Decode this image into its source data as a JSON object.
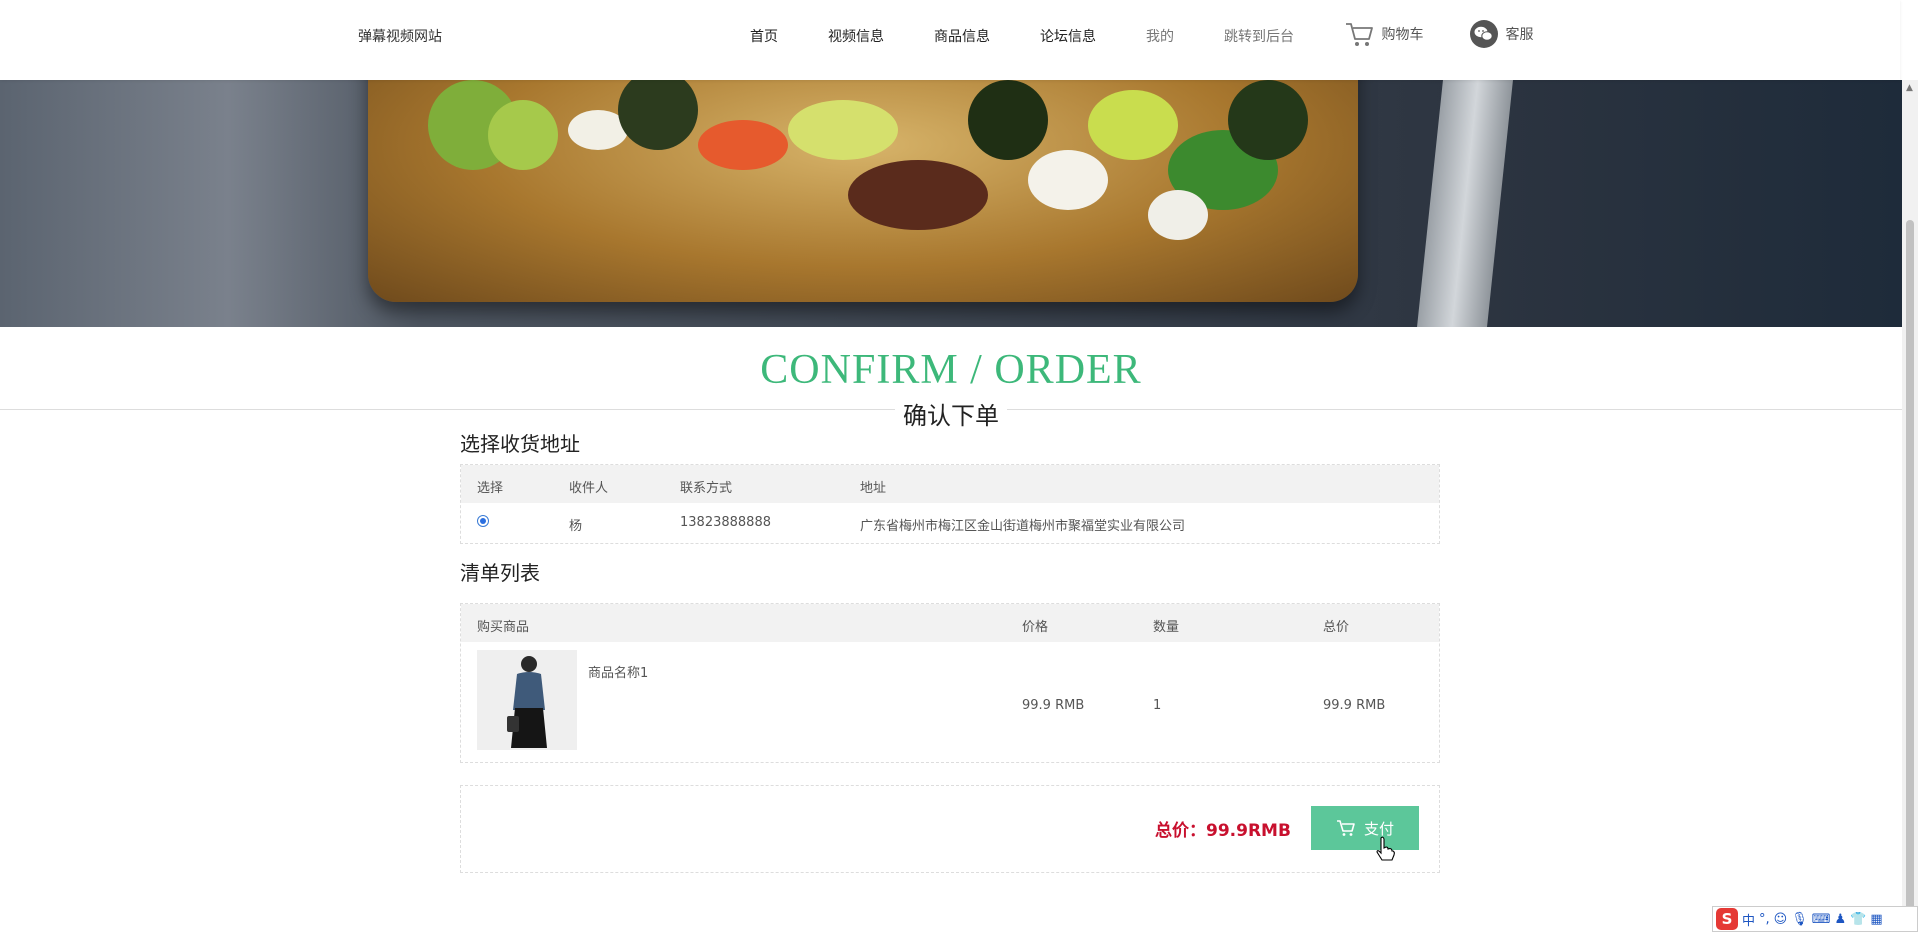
{
  "header": {
    "site_title": "弹幕视频网站",
    "nav": [
      "首页",
      "视频信息",
      "商品信息",
      "论坛信息",
      "我的",
      "跳转到后台"
    ],
    "cart_label": "购物车",
    "service_label": "客服"
  },
  "page": {
    "title_en": "CONFIRM / ORDER",
    "title_cn": "确认下单"
  },
  "address": {
    "section_title": "选择收货地址",
    "headers": [
      "选择",
      "收件人",
      "联系方式",
      "地址"
    ],
    "rows": [
      {
        "selected": true,
        "recipient": "杨",
        "phone": "13823888888",
        "address": "广东省梅州市梅江区金山街道梅州市聚福堂实业有限公司"
      }
    ]
  },
  "cart": {
    "section_title": "清单列表",
    "headers": [
      "购买商品",
      "价格",
      "数量",
      "总价"
    ],
    "items": [
      {
        "name": "商品名称1",
        "price": "99.9 RMB",
        "qty": "1",
        "subtotal": "99.9 RMB"
      }
    ]
  },
  "summary": {
    "total_label": "总价：99.9RMB",
    "pay_label": "支付"
  },
  "ime": {
    "logo": "S",
    "mode": "中"
  },
  "colors": {
    "accent": "#3db87a",
    "pay_button": "#5cc79a",
    "total": "#c8102e"
  }
}
